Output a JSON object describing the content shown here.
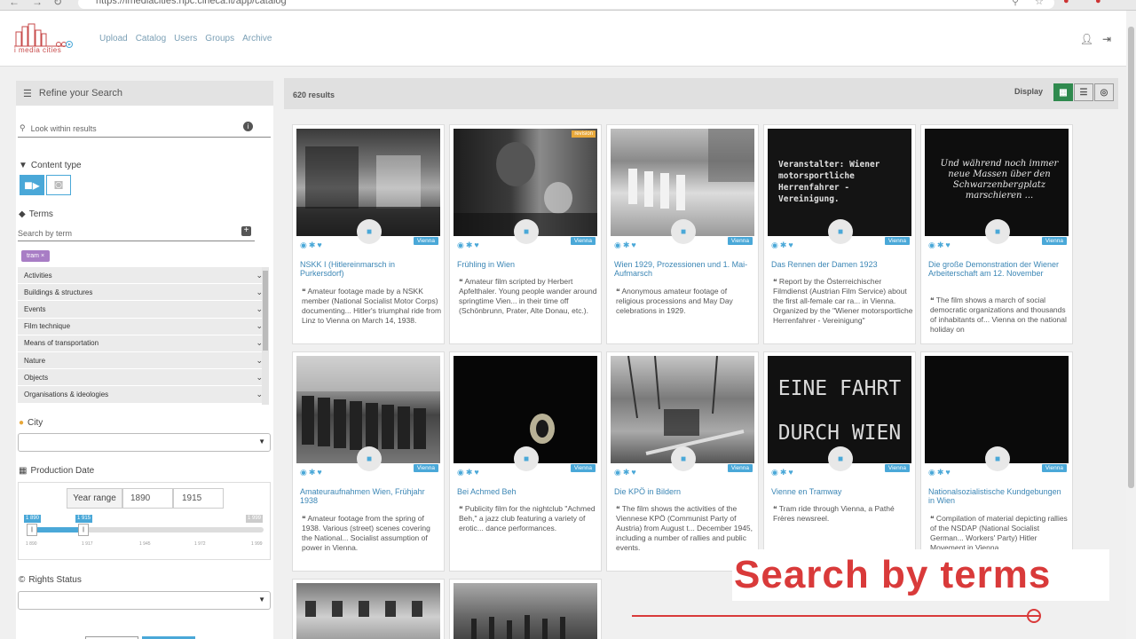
{
  "browser": {
    "url": "https://imediacities.hpc.cineca.it/app/catalog"
  },
  "logo": {
    "text": "i media cities"
  },
  "nav": [
    "Upload",
    "Catalog",
    "Users",
    "Groups",
    "Archive"
  ],
  "sidebar": {
    "refine_title": "Refine your Search",
    "look_placeholder": "Look within results",
    "content_type_label": "Content type",
    "terms_label": "Terms",
    "term_search_placeholder": "Search by term",
    "active_tag": "tram ×",
    "term_categories": [
      "Activities",
      "Buildings & structures",
      "Events",
      "Film technique",
      "Means of transportation",
      "Nature",
      "Objects",
      "Organisations & ideologies"
    ],
    "city_label": "City",
    "production_label": "Production Date",
    "year_range_label": "Year range",
    "year_from": "1890",
    "year_to": "1915",
    "slider_badge_from": "1 890",
    "slider_badge_to": "1 915",
    "slider_max_badge": "1 999",
    "slider_ticks": [
      "1 890",
      "1 917",
      "1 945",
      "1 972",
      "1 999"
    ],
    "rights_label": "Rights Status"
  },
  "main": {
    "results": "620 results",
    "display_label": "Display"
  },
  "cards": [
    {
      "title": "NSKK I (Hitlereinmarsch in Purkersdorf)",
      "city": "Vienna",
      "desc": "Amateur footage made by a NSKK member (National Socialist Motor Corps) documenting... Hitler's triumphal ride from Linz to Vienna on March 14, 1938."
    },
    {
      "title": "Frühling in Wien",
      "city": "Vienna",
      "desc": "Amateur film scripted by Herbert Apfelthaler. Young people wander around springtime Vien... in their time off (Schönbrunn, Prater, Alte Donau, etc.).",
      "badge": "revision"
    },
    {
      "title": "Wien 1929, Prozessionen und 1. Mai-Aufmarsch",
      "city": "Vienna",
      "desc": "Anonymous amateur footage of religious processions and May Day celebrations in 1929."
    },
    {
      "title": "Das Rennen der Damen 1923",
      "city": "Vienna",
      "desc": "Report by the Österreichischer Filmdienst (Austrian Film Service) about the first all-female car ra... in Vienna. Organized by the \"Wiener motorsportliche Herrenfahrer - Vereinigung\"",
      "thumb_text": "Veranstalter: Wiener motorsportliche Herrenfahrer - Vereinigung."
    },
    {
      "title": "Die große Demonstration der Wiener Arbeiterschaft am 12. November",
      "city": "Vienna",
      "desc": "The film shows a march of social democratic organizations and thousands of inhabitants of... Vienna on the national holiday on",
      "thumb_text": "Und während noch immer neue Massen über den Schwarzenbergplatz marschieren ..."
    },
    {
      "title": "Amateuraufnahmen Wien, Frühjahr 1938",
      "city": "Vienna",
      "desc": "Amateur footage from the spring of 1938. Various (street) scenes covering the National... Socialist assumption of power in Vienna."
    },
    {
      "title": "Bei Achmed Beh",
      "city": "Vienna",
      "desc": "Publicity film for the nightclub \"Achmed Beh,\" a jazz club featuring a variety of erotic... dance performances."
    },
    {
      "title": "Die KPÖ in Bildern",
      "city": "Vienna",
      "desc": "The film shows the activities of the Viennese KPÖ (Communist Party of Austria) from August t... December 1945, including a number of rallies and public events."
    },
    {
      "title": "Vienne en Tramway",
      "city": "Vienna",
      "desc": "Tram ride through Vienna, a Pathé Frères newsreel.",
      "thumb_text": "EINE FAHRT DURCH WIEN"
    },
    {
      "title": "Nationalsozialistische Kundgebungen in Wien",
      "city": "Vienna",
      "desc": "Compilation of material depicting rallies of the NSDAP (National Socialist German... Workers' Party) Hitler Movement in Vienna..."
    }
  ],
  "overlay": {
    "text": "Search by terms"
  },
  "colors": {
    "accent": "#4aa8d8",
    "overlay_red": "#d93a3a",
    "tag_purple": "#a87dc5",
    "display_active": "#2f8a4e"
  }
}
